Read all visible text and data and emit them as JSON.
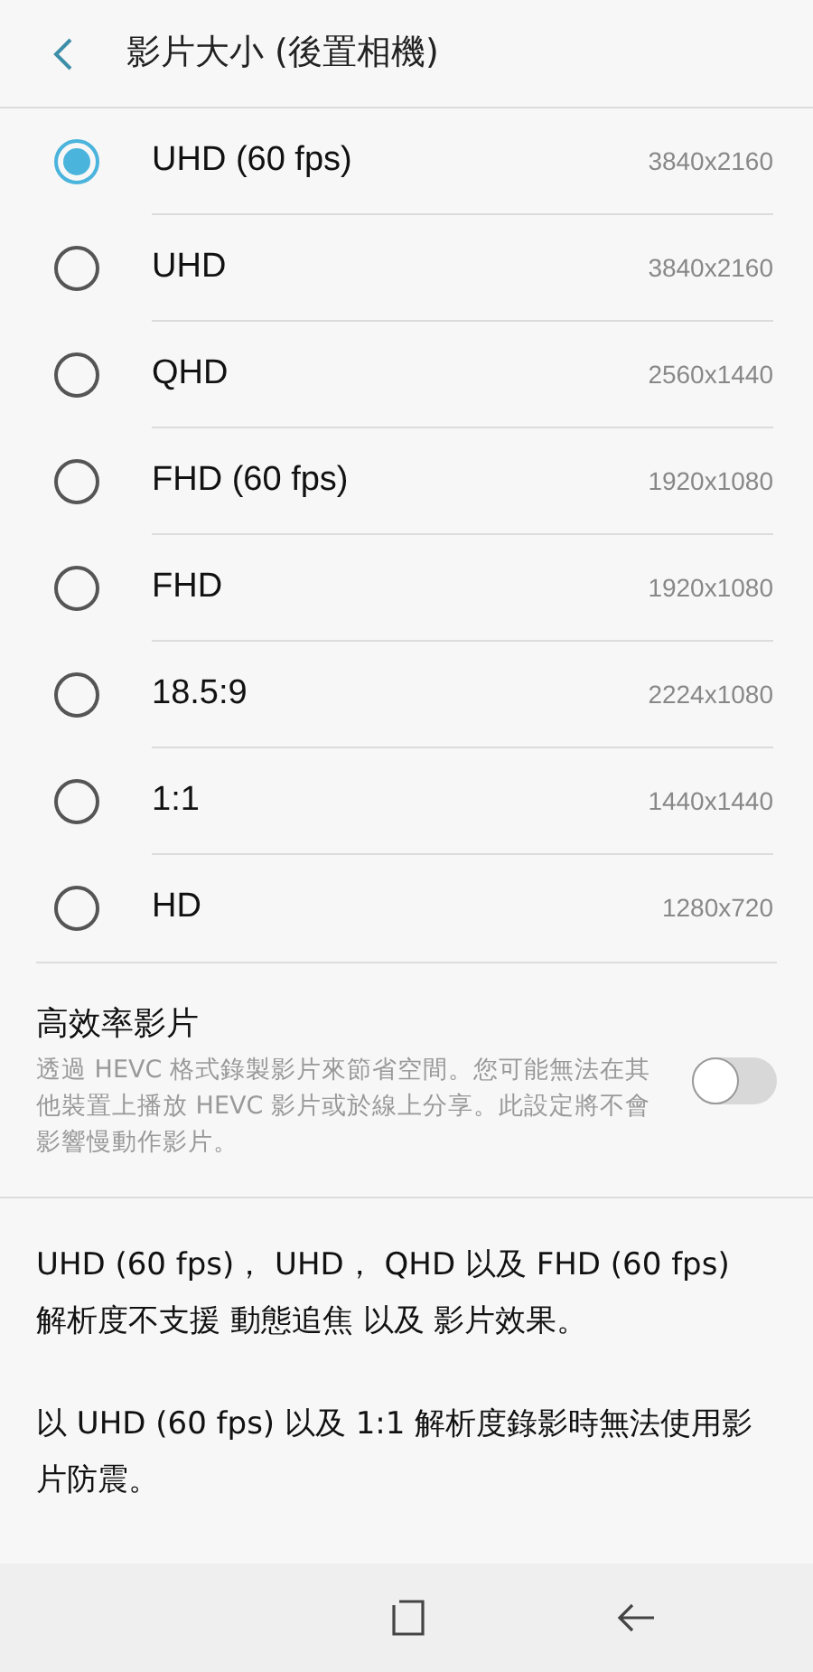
{
  "header": {
    "title": "影片大小 (後置相機)"
  },
  "options": [
    {
      "label": "UHD (60 fps)",
      "resolution": "3840x2160",
      "selected": true
    },
    {
      "label": "UHD",
      "resolution": "3840x2160",
      "selected": false
    },
    {
      "label": "QHD",
      "resolution": "2560x1440",
      "selected": false
    },
    {
      "label": "FHD (60 fps)",
      "resolution": "1920x1080",
      "selected": false
    },
    {
      "label": "FHD",
      "resolution": "1920x1080",
      "selected": false
    },
    {
      "label": "18.5:9",
      "resolution": "2224x1080",
      "selected": false
    },
    {
      "label": "1:1",
      "resolution": "1440x1440",
      "selected": false
    },
    {
      "label": "HD",
      "resolution": "1280x720",
      "selected": false
    }
  ],
  "hevc": {
    "title": "高效率影片",
    "description": "透過 HEVC 格式錄製影片來節省空間。您可能無法在其他裝置上播放 HEVC 影片或於線上分享。此設定將不會影響慢動作影片。",
    "on": false
  },
  "notes": [
    "UHD (60 fps)， UHD， QHD 以及 FHD (60 fps) 解析度不支援 動態追焦 以及 影片效果。",
    "以 UHD (60 fps) 以及 1:1 解析度錄影時無法使用影片防震。"
  ]
}
